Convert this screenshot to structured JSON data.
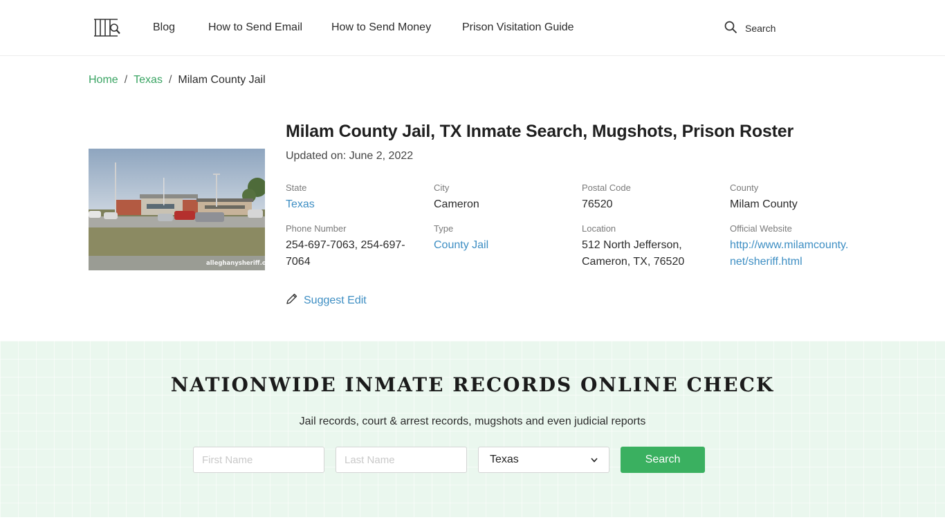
{
  "header": {
    "logo_icon": "jail-bars-search-logo",
    "nav": [
      {
        "label": "Blog"
      },
      {
        "label": "How to Send Email"
      },
      {
        "label": "How to Send Money"
      },
      {
        "label": "Prison Visitation Guide"
      }
    ],
    "search_label": "Search"
  },
  "breadcrumb": {
    "items": [
      {
        "label": "Home"
      },
      {
        "label": "Texas"
      },
      {
        "label": "Milam County Jail"
      }
    ],
    "separator": "/"
  },
  "facility": {
    "title": "Milam County Jail, TX Inmate Search, Mugshots, Prison Roster",
    "updated": "Updated on: June 2, 2022",
    "photo_watermark": "alleghanysheriff.org",
    "fields": {
      "state": {
        "label": "State",
        "value": "Texas"
      },
      "city": {
        "label": "City",
        "value": "Cameron"
      },
      "postal": {
        "label": "Postal Code",
        "value": "76520"
      },
      "county": {
        "label": "County",
        "value": "Milam County"
      },
      "phone": {
        "label": "Phone Number",
        "line1": "254-697-7063, 254-697-",
        "line2": "7064"
      },
      "type": {
        "label": "Type",
        "value": "County Jail"
      },
      "location": {
        "label": "Location",
        "line1": "512 North Jefferson,",
        "line2": "Cameron, TX, 76520"
      },
      "website": {
        "label": "Official Website",
        "line1": "http://www.milamcounty.",
        "line2": "net/sheriff.html"
      }
    },
    "suggest_edit": "Suggest Edit"
  },
  "records_search": {
    "title": "NATIONWIDE INMATE RECORDS ONLINE CHECK",
    "subtitle": "Jail records, court & arrest records, mugshots and even judicial reports",
    "first_name_placeholder": "First Name",
    "last_name_placeholder": "Last Name",
    "state_selected": "Texas",
    "button_label": "Search"
  },
  "colors": {
    "link_green": "#3aa463",
    "link_blue": "#3d8ec3",
    "button_green": "#3ab060",
    "band_bg": "#eaf7ee"
  }
}
